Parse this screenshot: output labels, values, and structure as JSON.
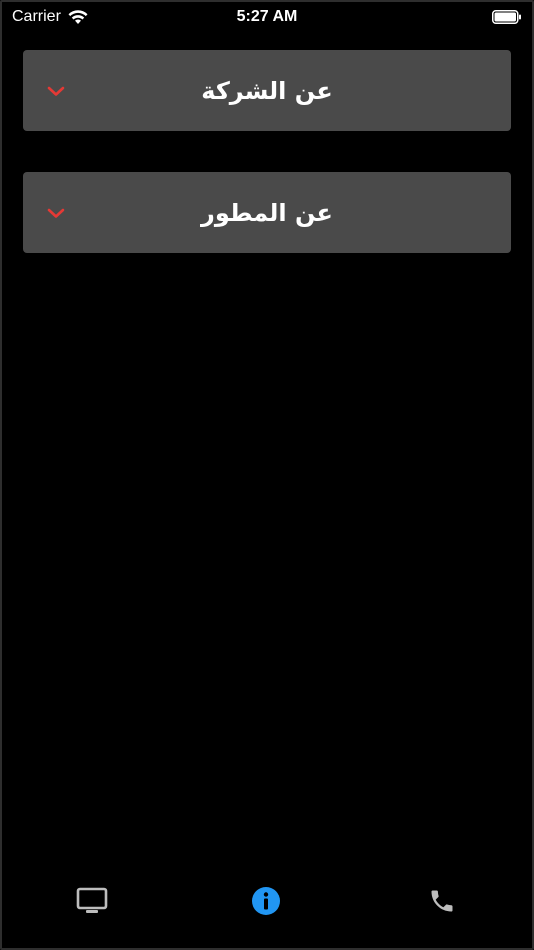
{
  "status_bar": {
    "carrier": "Carrier",
    "time": "5:27 AM",
    "wifi_icon": "wifi-icon",
    "battery_icon": "battery-full-icon"
  },
  "accordion": {
    "items": [
      {
        "title": "عن الشركة",
        "icon": "chevron-down-icon",
        "expanded": false
      },
      {
        "title": "عن المطور",
        "icon": "chevron-down-icon",
        "expanded": false
      }
    ]
  },
  "tab_bar": {
    "tabs": [
      {
        "icon": "tv-icon",
        "active": false
      },
      {
        "icon": "info-icon",
        "active": true
      },
      {
        "icon": "phone-icon",
        "active": false
      }
    ]
  },
  "colors": {
    "background": "#000000",
    "panel": "#4a4a4a",
    "chevron": "#e53935",
    "active_tab": "#2196f3",
    "inactive_tab": "#bdbdbd",
    "text": "#ffffff"
  }
}
